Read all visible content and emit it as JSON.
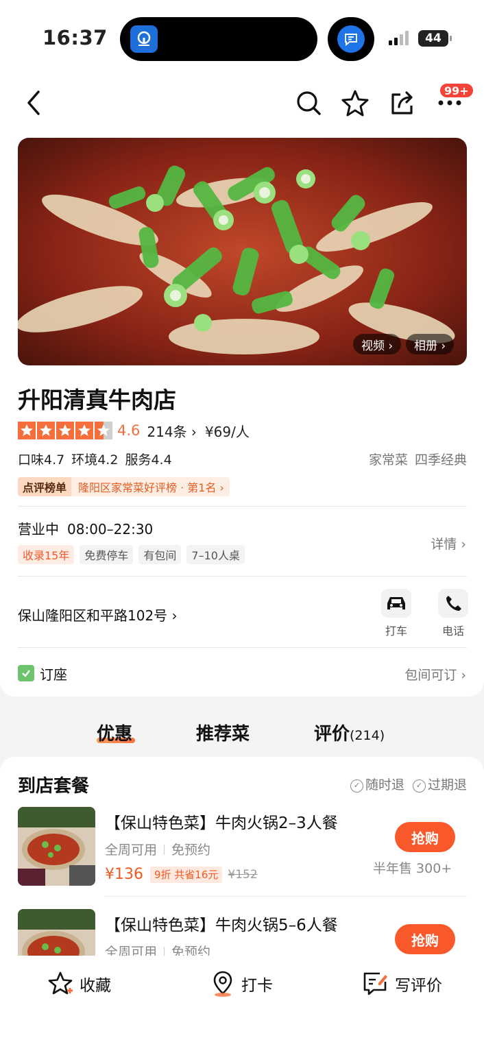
{
  "status_bar": {
    "time": "16:37",
    "battery": "44"
  },
  "nav": {
    "badge": "99+"
  },
  "hero": {
    "video_label": "视频 ›",
    "album_label": "相册 ›"
  },
  "shop": {
    "name": "升阳清真牛肉店",
    "rating": 4.5,
    "score": "4.6",
    "review_count": "214条 ›",
    "avg_price": "¥69/人",
    "scores": [
      "口味4.7",
      "环境4.2",
      "服务4.4"
    ],
    "categories": [
      "家常菜",
      "四季经典"
    ],
    "rank_label": "点评榜单",
    "rank_text": "隆阳区家常菜好评榜 · 第1名 ›",
    "status": "营业中",
    "hours": "08:00–22:30",
    "tags": [
      "收录15年",
      "免费停车",
      "有包间",
      "7–10人桌"
    ],
    "detail_link": "详情 ›",
    "address": "保山隆阳区和平路102号 ›",
    "actions": {
      "taxi": "打车",
      "phone": "电话"
    },
    "booking": "订座",
    "booking_right": "包间可订 ›"
  },
  "tabs": {
    "offers": "优惠",
    "dishes": "推荐菜",
    "reviews": "评价",
    "reviews_count": "(214)"
  },
  "deals": {
    "title": "到店套餐",
    "guarantees": [
      "随时退",
      "过期退"
    ],
    "items": [
      {
        "name": "【保山特色菜】牛肉火锅2–3人餐",
        "usage": "全周可用",
        "reserve": "免预约",
        "price": "¥136",
        "discount": "9折 共省16元",
        "original": "¥152",
        "buy": "抢购",
        "sold": "半年售 300+"
      },
      {
        "name": "【保山特色菜】牛肉火锅5–6人餐",
        "usage": "全周可用",
        "reserve": "免预约",
        "buy": "抢购"
      }
    ]
  },
  "bottom_bar": {
    "favorite": "收藏",
    "checkin": "打卡",
    "review": "写评价"
  },
  "colors": {
    "accent": "#f9592a",
    "rating": "#f46f3c"
  }
}
